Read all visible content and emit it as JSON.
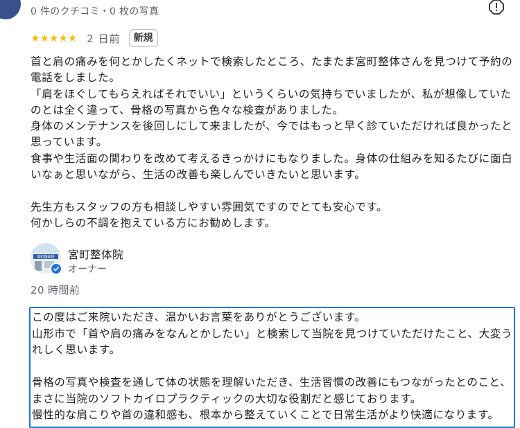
{
  "reviewer": {
    "stats": "0 件のクチコミ・0 枚の写真"
  },
  "review": {
    "stars": "★★★★★",
    "rating": 5,
    "date": "2 日前",
    "badge": "新規",
    "lines": [
      "首と肩の痛みを何とかしたくネットで検索したところ、たまたま宮町整体さんを見つけて予約の電話をしました。",
      "「肩をほぐしてもらえればそれでいい」というくらいの気持ちでいましたが、私が想像していたのとは全く違って、骨格の写真から色々な検査がありました。",
      "身体のメンテナンスを後回しにして来ましたが、今ではもっと早く診ていただければ良かったと思っています。",
      "食事や生活面の関わりを改めて考えるきっかけにもなりました。身体の仕組みを知るたびに面白いなぁと思いながら、生活の改善も楽しんでいきたいと思います。",
      "",
      "先生方もスタッフの方も相談しやすい雰囲気ですのでとても安心です。",
      "何かしらの不調を抱えている方にお勧めします。"
    ]
  },
  "owner": {
    "name": "宮町整体院",
    "role": "オーナー",
    "avatar_sign": "宮町整体院"
  },
  "reply": {
    "date": "20 時間前",
    "lines": [
      "この度はご来院いただき、温かいお言葉をありがとうございます。",
      "山形市で「首や肩の痛みをなんとかしたい」と検索して当院を見つけていただけたこと、大変うれしく思います。",
      "",
      "骨格の写真や検査を通して体の状態を理解いただき、生活習慣の改善にもつながったとのこと、まさに当院のソフトカイロプラクティックの大切な役割だと感じております。",
      "慢性的な肩こりや首の違和感も、根本から整えていくことで日常生活がより快適になります。"
    ]
  },
  "colors": {
    "star": "#fbbc04",
    "accent": "#1a73e8",
    "secondary_text": "#5f6368"
  },
  "icons": {
    "report": "report-flag-icon",
    "verified": "verified-badge-icon"
  }
}
